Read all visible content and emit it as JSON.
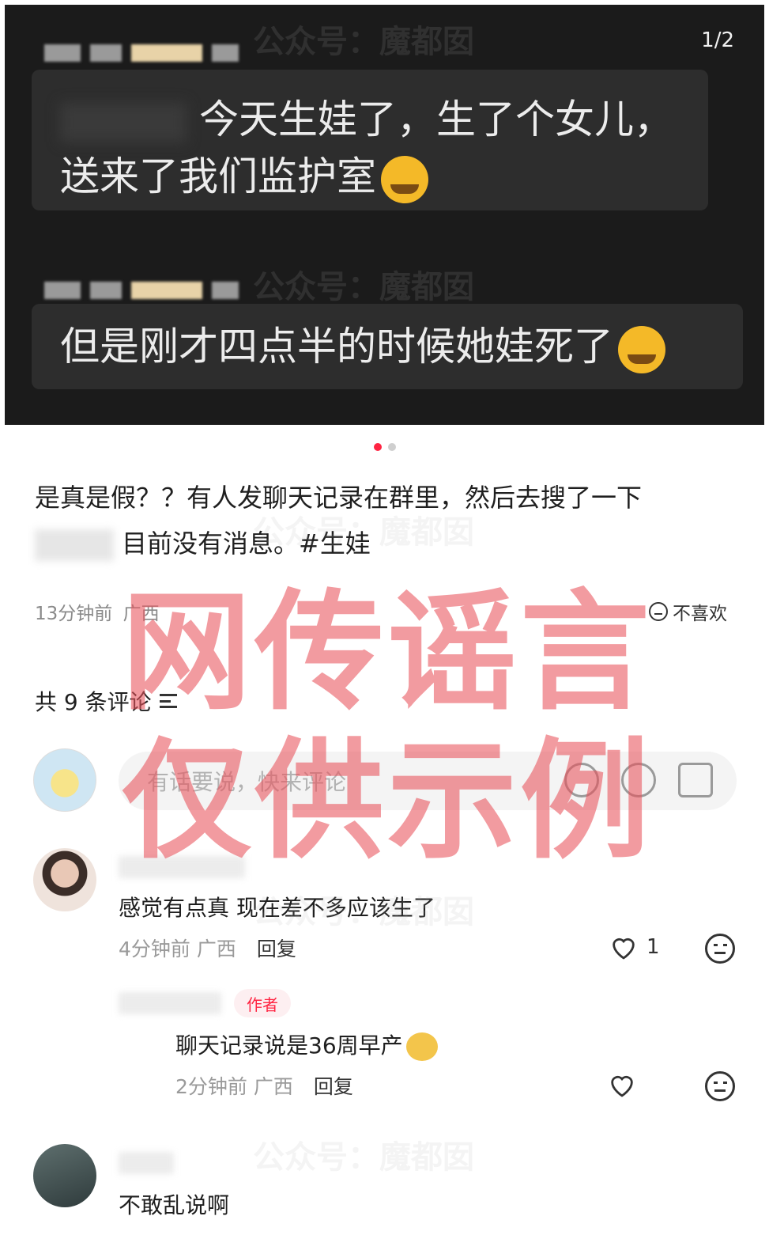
{
  "image": {
    "counter": "1/2",
    "messages": [
      {
        "line1": "今天生娃了，生了个女儿，",
        "line2": "送来了我们监护室"
      },
      {
        "text": "但是刚才四点半的时候她娃死了"
      }
    ]
  },
  "post": {
    "line1": "是真是假？？有人发聊天记录在群里，然后去搜了一下",
    "line2": "目前没有消息。#生娃",
    "time": "13分钟前",
    "location": "广西",
    "dislike_label": "不喜欢"
  },
  "comments_header": "共 9 条评论",
  "input": {
    "placeholder": "有话要说，快来评论"
  },
  "comments": [
    {
      "text": "感觉有点真 现在差不多应该生了",
      "time": "4分钟前",
      "location": "广西",
      "reply": "回复",
      "likes": "1"
    },
    {
      "tag": "作者",
      "text": "聊天记录说是36周早产",
      "time": "2分钟前",
      "location": "广西",
      "reply": "回复"
    },
    {
      "text": "不敢乱说啊"
    }
  ],
  "overlay": {
    "line1": "网传谣言",
    "line2": "仅供示例"
  },
  "watermark": "公众号：魔都囡",
  "colors": {
    "accent": "#ff2442",
    "stamp": "#e8525c",
    "dark_bg": "#1b1b1b"
  }
}
